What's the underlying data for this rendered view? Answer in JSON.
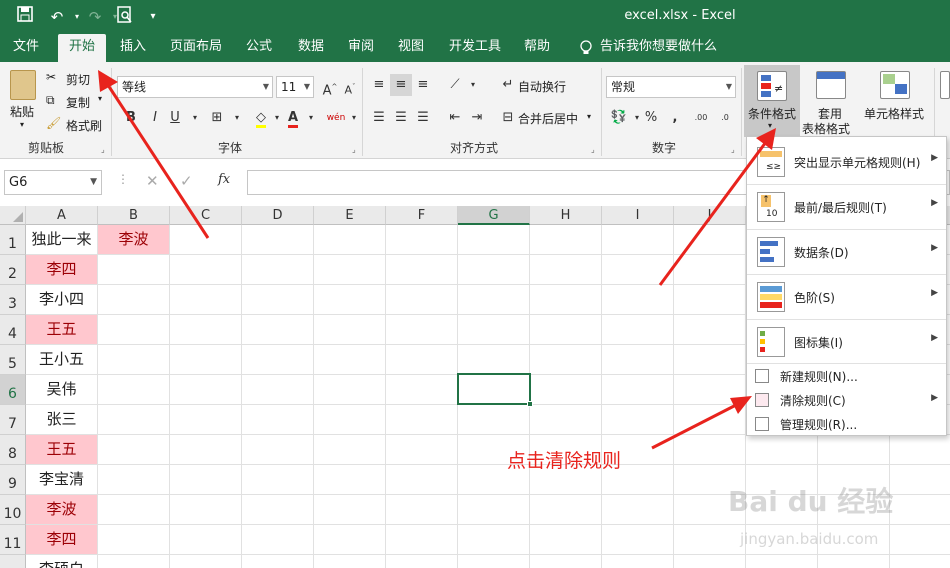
{
  "title_bar": {
    "doc_title": "excel.xlsx  -  Excel",
    "quick_access": [
      "save-icon",
      "undo-icon",
      "redo-icon",
      "print-preview-icon",
      "customize-icon"
    ]
  },
  "tabs": [
    "文件",
    "开始",
    "插入",
    "页面布局",
    "公式",
    "数据",
    "审阅",
    "视图",
    "开发工具",
    "帮助"
  ],
  "active_tab": "开始",
  "tell_me": "告诉我你想要做什么",
  "ribbon": {
    "clipboard": {
      "paste": "粘贴",
      "cut": "剪切",
      "copy": "复制",
      "format_painter": "格式刷",
      "label": "剪贴板"
    },
    "font": {
      "font_name": "等线",
      "font_size": "11",
      "bold": "B",
      "italic": "I",
      "underline": "U",
      "label": "字体"
    },
    "alignment": {
      "wrap": "自动换行",
      "merge": "合并后居中",
      "label": "对齐方式"
    },
    "number": {
      "format": "常规",
      "percent": "%",
      "comma": ",",
      "label": "数字"
    },
    "styles": {
      "conditional": "条件格式",
      "table_format_1": "套用",
      "table_format_2": "表格格式",
      "cell_styles": "单元格样式"
    }
  },
  "formula_bar": {
    "name_box": "G6",
    "fx": "fx",
    "cancel": "✕",
    "enter": "✓"
  },
  "columns": [
    "A",
    "B",
    "C",
    "D",
    "E",
    "F",
    "G",
    "H",
    "I",
    "J"
  ],
  "rows": [
    {
      "num": "1",
      "A": "独此一来",
      "A_pink": false,
      "B": "李波",
      "B_pink": true
    },
    {
      "num": "2",
      "A": "李四",
      "A_pink": true,
      "B": "",
      "B_pink": false
    },
    {
      "num": "3",
      "A": "李小四",
      "A_pink": false,
      "B": "",
      "B_pink": false
    },
    {
      "num": "4",
      "A": "王五",
      "A_pink": true,
      "B": "",
      "B_pink": false
    },
    {
      "num": "5",
      "A": "王小五",
      "A_pink": false,
      "B": "",
      "B_pink": false
    },
    {
      "num": "6",
      "A": "吴伟",
      "A_pink": false,
      "B": "",
      "B_pink": false
    },
    {
      "num": "7",
      "A": "张三",
      "A_pink": false,
      "B": "",
      "B_pink": false
    },
    {
      "num": "8",
      "A": "王五",
      "A_pink": true,
      "B": "",
      "B_pink": false
    },
    {
      "num": "9",
      "A": "李宝清",
      "A_pink": false,
      "B": "",
      "B_pink": false
    },
    {
      "num": "10",
      "A": "李波",
      "A_pink": true,
      "B": "",
      "B_pink": false
    },
    {
      "num": "11",
      "A": "李四",
      "A_pink": true,
      "B": "",
      "B_pink": false
    },
    {
      "num": "",
      "A": "李硕白",
      "A_pink": false,
      "B": "",
      "B_pink": false
    }
  ],
  "selected_cell": "G6",
  "cf_menu": {
    "highlight": "突出显示单元格规则(H)",
    "topbottom": "前/最后规则(T)",
    "topbottom_prefix": "最",
    "databar": "数据条(D)",
    "colorscale": "色阶(S)",
    "iconset": "图标集(I)",
    "new_rule": "新建规则(N)...",
    "clear_rule": "清除规则(C)",
    "manage_rule": "管理规则(R)..."
  },
  "annotation": "点击清除规则",
  "watermark": "Bai du 经验",
  "watermark_url": "jingyan.baidu.com",
  "colors": {
    "excel_green": "#217346",
    "pink_fill": "#ffc7ce",
    "pink_text": "#9c0006",
    "annotation_red": "#e8231d"
  }
}
